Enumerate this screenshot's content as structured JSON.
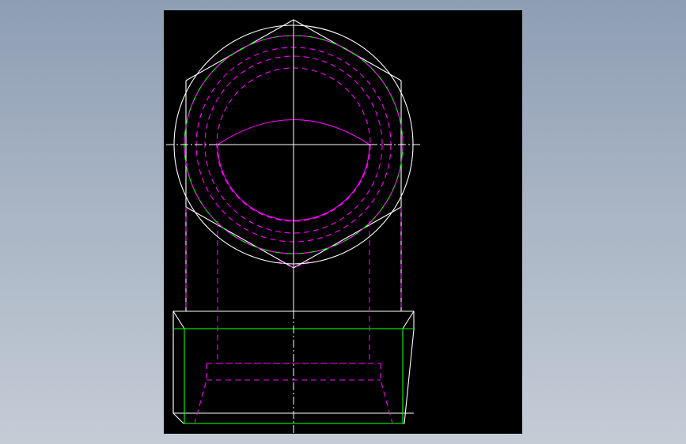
{
  "viewport": {
    "background": "#000000"
  },
  "colors": {
    "outline": "#ffffff",
    "centerline": "#ffffff",
    "hidden": "#ff00ff",
    "visible_edge": "#00ff00",
    "thread": "#ff00ff"
  },
  "drawing": {
    "type": "cad-orthographic-view",
    "part": "hex-fitting-with-thread",
    "line_types": [
      "continuous",
      "dashed",
      "center"
    ]
  }
}
